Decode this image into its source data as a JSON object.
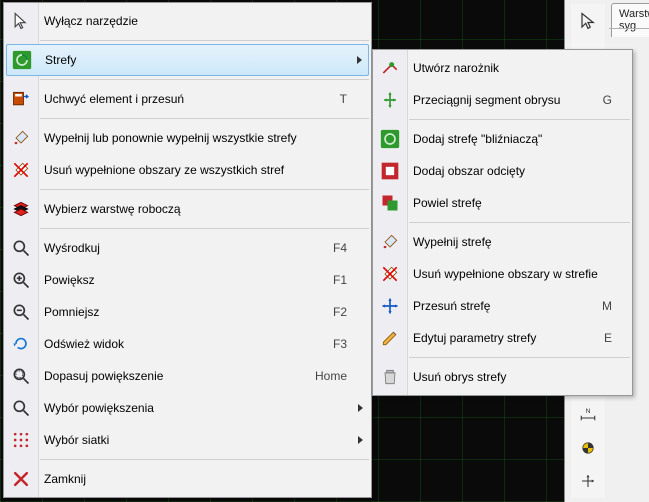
{
  "main_menu": {
    "disable_tool": "Wyłącz narzędzie",
    "zones": "Strefy",
    "grab_move": "Uchwyć element i przesuń",
    "grab_move_key": "T",
    "fill_all": "Wypełnij lub ponownie wypełnij wszystkie strefy",
    "remove_all": "Usuń wypełnione obszary ze wszystkich stref",
    "select_layer": "Wybierz warstwę roboczą",
    "center": "Wyśrodkuj",
    "center_key": "F4",
    "zoom_in": "Powiększ",
    "zoom_in_key": "F1",
    "zoom_out": "Pomniejsz",
    "zoom_out_key": "F2",
    "refresh": "Odśwież widok",
    "refresh_key": "F3",
    "fit": "Dopasuj powiększenie",
    "fit_key": "Home",
    "zoom_sel": "Wybór powiększenia",
    "grid_sel": "Wybór siatki",
    "close": "Zamknij"
  },
  "sub_menu": {
    "create_corner": "Utwórz narożnik",
    "drag_seg": "Przeciągnij segment obrysu",
    "drag_seg_key": "G",
    "add_twin": "Dodaj strefę \"bliźniaczą\"",
    "add_cut": "Dodaj obszar odcięty",
    "dup_zone": "Powiel strefę",
    "fill_zone": "Wypełnij strefę",
    "remove_fill": "Usuń wypełnione obszary w strefie",
    "move_zone": "Przesuń strefę",
    "move_zone_key": "M",
    "edit_params": "Edytuj parametry strefy",
    "edit_params_key": "E",
    "delete_outline": "Usuń obrys strefy"
  },
  "right": {
    "tab": "Warstwy syg"
  }
}
